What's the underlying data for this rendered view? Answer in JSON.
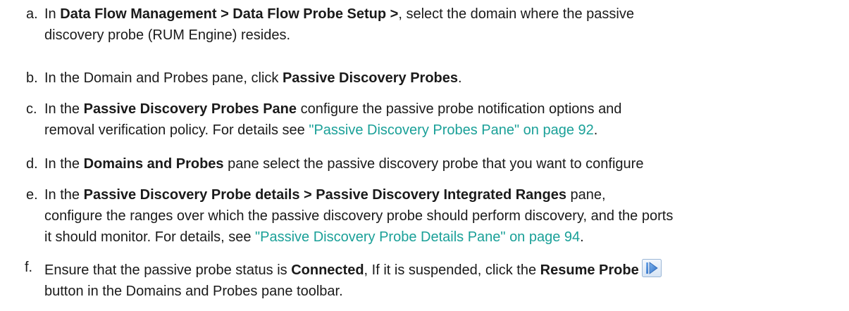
{
  "steps": [
    {
      "marker": "a.",
      "line1": {
        "t1": "In ",
        "b1": "Data Flow Management > Data Flow Probe Setup >",
        "t2": ", select the domain where the passive"
      },
      "line2": {
        "t1": "discovery probe (RUM Engine) resides."
      }
    },
    {
      "marker": "b.",
      "line1": {
        "t1": "In the Domain and Probes pane, click ",
        "b1": "Passive Discovery Probes",
        "t2": "."
      }
    },
    {
      "marker": "c.",
      "line1": {
        "t1": "In the ",
        "b1": "Passive Discovery Probes Pane",
        "t2": " configure the passive probe notification options and"
      },
      "line2": {
        "t1": "removal verification policy. For details see ",
        "link": "\"Passive Discovery Probes Pane\" on page 92",
        "t2": "."
      }
    },
    {
      "marker": "d.",
      "line1": {
        "t1": "In the ",
        "b1": "Domains and Probes",
        "t2": " pane select the passive discovery probe that you want to configure"
      }
    },
    {
      "marker": "e.",
      "line1": {
        "t1": "In the ",
        "b1": "Passive Discovery Probe details > Passive Discovery Integrated Ranges",
        "t2": " pane,"
      },
      "line2": {
        "t1": "configure the ranges over which the passive discovery probe should perform discovery, and the ports"
      },
      "line3": {
        "t1": "it should monitor. For details, see ",
        "link": "\"Passive Discovery Probe Details Pane\" on page 94",
        "t2": "."
      }
    },
    {
      "marker": "f.",
      "line1": {
        "t1": "Ensure that the passive probe status is ",
        "b1": "Connected",
        "t2": ", If it is suspended, click the ",
        "b2": "Resume Probe",
        "icon": "resume-probe-icon"
      },
      "line2": {
        "t1": "button in the Domains and Probes pane toolbar."
      }
    }
  ],
  "colors": {
    "text": "#1a1a1a",
    "link": "#1aa098",
    "icon_border": "#9ab6d6",
    "icon_arrow": "#3a7fd0"
  }
}
